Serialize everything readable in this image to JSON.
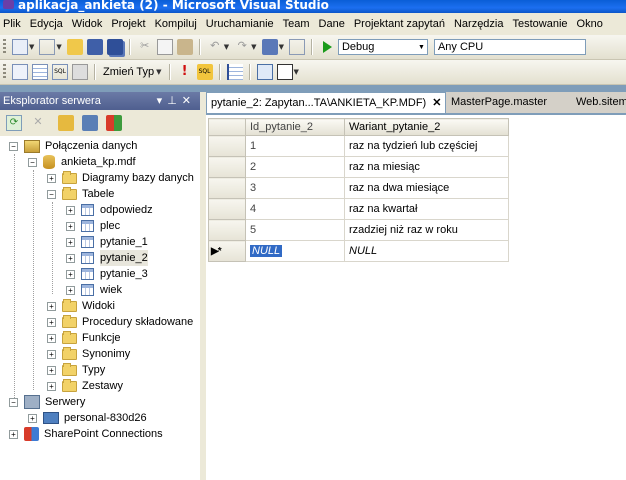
{
  "window": {
    "title": "aplikacja_ankieta (2) - Microsoft Visual Studio"
  },
  "menu": [
    "Plik",
    "Edycja",
    "Widok",
    "Projekt",
    "Kompiluj",
    "Uruchamianie",
    "Team",
    "Dane",
    "Projektant zapytań",
    "Narzędzia",
    "Testowanie",
    "Okno"
  ],
  "toolbar1": {
    "config": "Debug",
    "platform": "Any CPU",
    "colors": {
      "play": "#1a9a1a"
    }
  },
  "toolbar2": {
    "change_type_label": "Zmień Typ"
  },
  "server_explorer": {
    "title": "Eksplorator serwera",
    "tree": {
      "connections": "Połączenia danych",
      "db": "ankieta_kp.mdf",
      "diagrams": "Diagramy bazy danych",
      "tables": "Tabele",
      "table_items": [
        "odpowiedz",
        "plec",
        "pytanie_1",
        "pytanie_2",
        "pytanie_3",
        "wiek"
      ],
      "views": "Widoki",
      "procedures": "Procedury składowane",
      "functions": "Funkcje",
      "synonyms": "Synonimy",
      "types": "Typy",
      "sets": "Zestawy",
      "servers": "Serwery",
      "server_name": "personal-830d26",
      "sharepoint": "SharePoint Connections"
    }
  },
  "tabs": {
    "active": "pytanie_2: Zapytan...TA\\ANKIETA_KP.MDF)",
    "close": "✕",
    "t2": "MasterPage.master",
    "t3": "Web.sitemap"
  },
  "grid": {
    "headers": [
      "Id_pytanie_2",
      "Wariant_pytanie_2"
    ],
    "rows": [
      [
        "1",
        "raz na tydzień lub częściej"
      ],
      [
        "2",
        "raz na miesiąc"
      ],
      [
        "3",
        "raz na dwa miesiące"
      ],
      [
        "4",
        "raz na kwartał"
      ],
      [
        "5",
        "rzadziej niż raz w roku"
      ]
    ],
    "new_row_marker": "▶*",
    "null_1": "NULL",
    "null_2": "NULL"
  }
}
